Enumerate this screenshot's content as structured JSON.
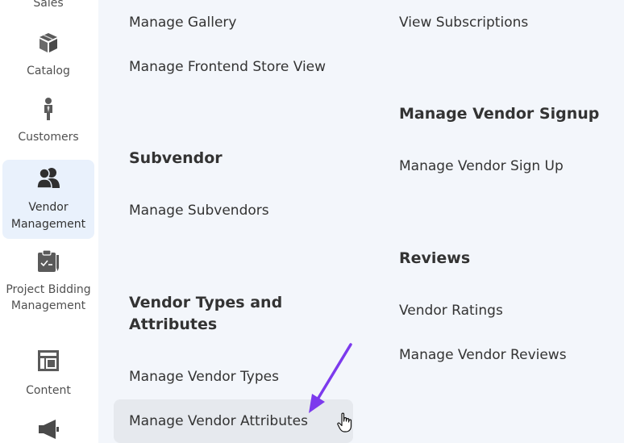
{
  "sidebar": {
    "items": [
      {
        "label": "Sales",
        "icon": "dollar-icon"
      },
      {
        "label": "Catalog",
        "icon": "cube-icon"
      },
      {
        "label": "Customers",
        "icon": "person-icon"
      },
      {
        "label": "Vendor Management",
        "icon": "users-icon",
        "active": true
      },
      {
        "label": "Project Bidding Management",
        "icon": "clipboard-icon"
      },
      {
        "label": "Content",
        "icon": "layout-icon"
      },
      {
        "label": "",
        "icon": "megaphone-icon"
      }
    ]
  },
  "menu": {
    "left": {
      "links_top": [
        "Manage Gallery",
        "Manage Frontend Store View"
      ],
      "subvendor": {
        "heading": "Subvendor",
        "links": [
          "Manage Subvendors"
        ]
      },
      "vendor_types": {
        "heading": "Vendor Types and Attributes",
        "links": [
          "Manage Vendor Types",
          "Manage Vendor Attributes"
        ]
      }
    },
    "right": {
      "links_top": [
        "View Subscriptions"
      ],
      "signup": {
        "heading": "Manage Vendor Signup",
        "links": [
          "Manage Vendor Sign Up"
        ]
      },
      "reviews": {
        "heading": "Reviews",
        "links": [
          "Vendor Ratings",
          "Manage Vendor Reviews"
        ]
      }
    }
  },
  "colors": {
    "active_bg": "#e9f1fc",
    "panel_bg": "#f3f6fb",
    "hover_bg": "#e6e9ee",
    "arrow": "#7c3aed"
  }
}
